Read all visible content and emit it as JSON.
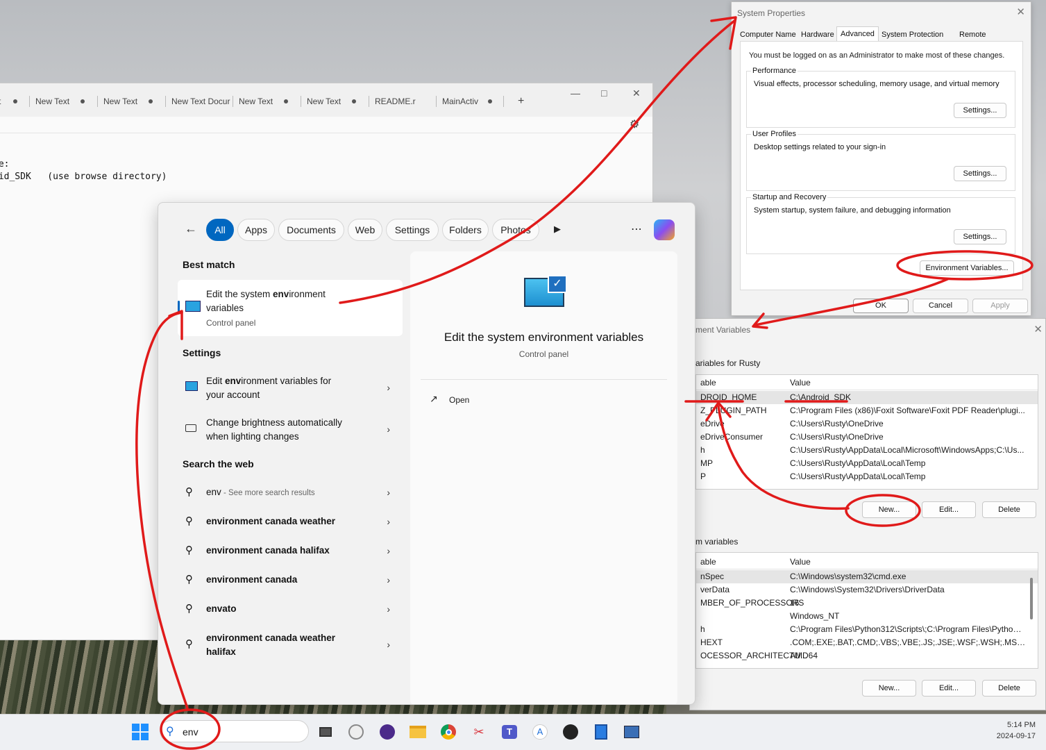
{
  "notepad": {
    "tabs": [
      "t",
      "New Text",
      "New Text",
      "New Text Docur",
      "New Text",
      "New Text",
      "README.r",
      "MainActiv"
    ],
    "lines": [
      "le:",
      "oid_SDK   (use browse directory)"
    ],
    "add_tab": "+"
  },
  "system_properties": {
    "title": "System Properties",
    "tabs": [
      "Computer Name",
      "Hardware",
      "Advanced",
      "System Protection",
      "Remote"
    ],
    "admin_note": "You must be logged on as an Administrator to make most of these changes.",
    "performance": {
      "label": "Performance",
      "text": "Visual effects, processor scheduling, memory usage, and virtual memory",
      "button": "Settings..."
    },
    "user_profiles": {
      "label": "User Profiles",
      "text": "Desktop settings related to your sign-in",
      "button": "Settings..."
    },
    "startup": {
      "label": "Startup and Recovery",
      "text": "System startup, system failure, and debugging information",
      "button": "Settings..."
    },
    "env_button": "Environment Variables...",
    "ok": "OK",
    "cancel": "Cancel",
    "apply": "Apply"
  },
  "env_vars": {
    "title": "ment Variables",
    "user_label": "ariables for Rusty",
    "col_name": "able",
    "col_value": "Value",
    "user_rows": [
      {
        "n": "DROID_HOME",
        "v": "C:\\Android_SDK"
      },
      {
        "n": "Z_PLUGIN_PATH",
        "v": "C:\\Program Files (x86)\\Foxit Software\\Foxit PDF Reader\\plugi..."
      },
      {
        "n": "eDrive",
        "v": "C:\\Users\\Rusty\\OneDrive"
      },
      {
        "n": "eDriveConsumer",
        "v": "C:\\Users\\Rusty\\OneDrive"
      },
      {
        "n": "h",
        "v": "C:\\Users\\Rusty\\AppData\\Local\\Microsoft\\WindowsApps;C:\\Us..."
      },
      {
        "n": "MP",
        "v": "C:\\Users\\Rusty\\AppData\\Local\\Temp"
      },
      {
        "n": "P",
        "v": "C:\\Users\\Rusty\\AppData\\Local\\Temp"
      }
    ],
    "sys_label": "m variables",
    "sys_rows": [
      {
        "n": "nSpec",
        "v": "C:\\Windows\\system32\\cmd.exe"
      },
      {
        "n": "verData",
        "v": "C:\\Windows\\System32\\Drivers\\DriverData"
      },
      {
        "n": "MBER_OF_PROCESSORS",
        "v": "16"
      },
      {
        "n": "",
        "v": "Windows_NT"
      },
      {
        "n": "h",
        "v": "C:\\Program Files\\Python312\\Scripts\\;C:\\Program Files\\Python3..."
      },
      {
        "n": "HEXT",
        "v": ".COM;.EXE;.BAT;.CMD;.VBS;.VBE;.JS;.JSE;.WSF;.WSH;.MSC;.PY;.PYW"
      },
      {
        "n": "OCESSOR_ARCHITECTU...",
        "v": "AMD64"
      }
    ],
    "new": "New...",
    "edit": "Edit...",
    "delete": "Delete"
  },
  "search": {
    "chips": [
      "All",
      "Apps",
      "Documents",
      "Web",
      "Settings",
      "Folders",
      "Photos"
    ],
    "best_match_label": "Best match",
    "best_match": {
      "title_pre": "Edit the system ",
      "title_bold": "env",
      "title_post": "ironment",
      "title_line2": "variables",
      "sub": "Control panel"
    },
    "settings_label": "Settings",
    "settings_items": [
      {
        "pre": "Edit ",
        "bold": "env",
        "post": "ironment variables for",
        "line2": "your account"
      },
      {
        "pre": "Change brightness automatically",
        "bold": "",
        "post": "",
        "line2": "when lighting changes"
      }
    ],
    "web_label": "Search the web",
    "web_first": {
      "bold": "env",
      "sub": " - See more search results"
    },
    "web_items": [
      "environment canada weather",
      "environment canada halifax",
      "environment canada",
      "envato",
      "environment canada weather"
    ],
    "web_last_line2": "halifax",
    "detail_title": "Edit the system environment variables",
    "detail_sub": "Control panel",
    "open": "Open",
    "query": "env"
  },
  "taskbar": {
    "time": "5:14 PM",
    "date": "2024-09-17"
  }
}
